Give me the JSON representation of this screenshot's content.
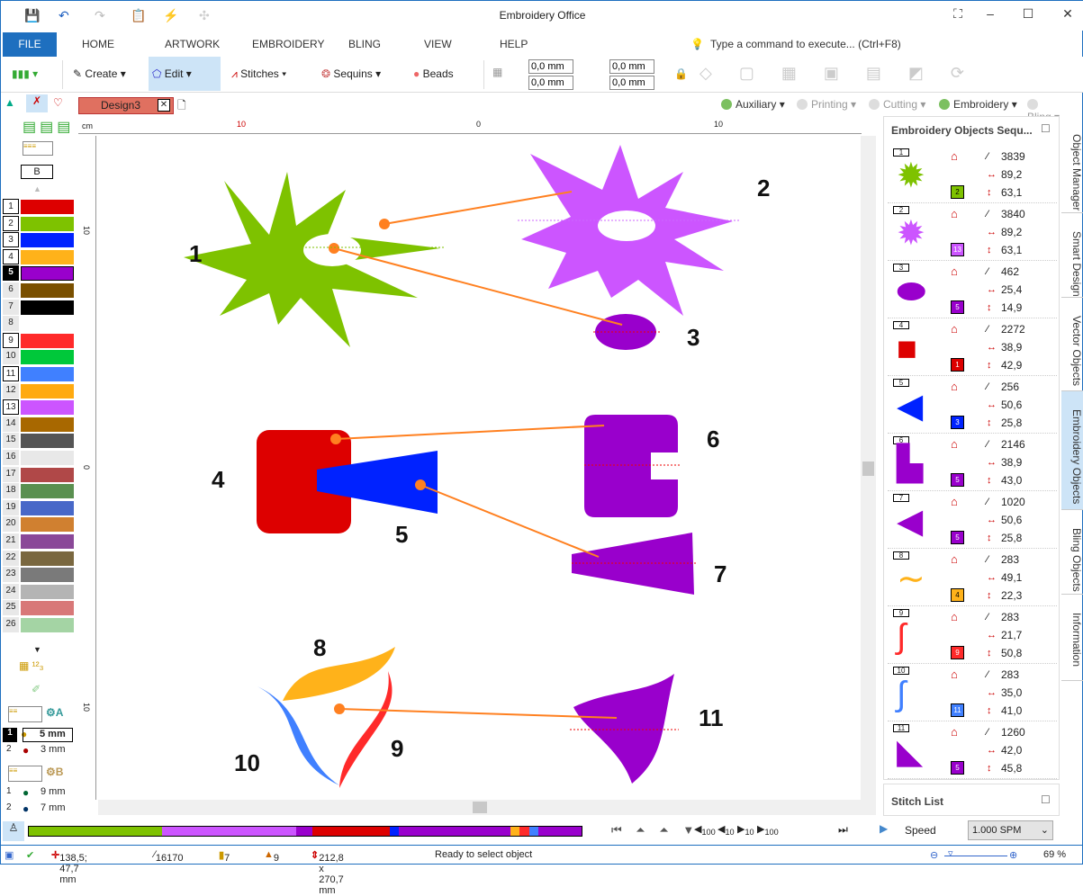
{
  "app": {
    "title": "Embroidery Office"
  },
  "ribbon_tabs": [
    "FILE",
    "HOME",
    "ARTWORK",
    "EMBROIDERY",
    "BLING",
    "VIEW",
    "HELP"
  ],
  "command_search": "Type a command to execute... (Ctrl+F8)",
  "toolbar": {
    "create": "Create",
    "edit": "Edit",
    "stitches": "Stitches",
    "sequins": "Sequins",
    "beads": "Beads",
    "pos_x": "0,0 mm",
    "pos_y": "0,0 mm",
    "width": "0,0 mm",
    "height": "0,0 mm"
  },
  "layers": [
    {
      "label": "Auxiliary",
      "on": true
    },
    {
      "label": "Printing",
      "on": false
    },
    {
      "label": "Cutting",
      "on": false
    },
    {
      "label": "Embroidery",
      "on": true
    },
    {
      "label": "Bling",
      "on": false
    }
  ],
  "document_tab": "Design3",
  "ruler": {
    "unit": "cm",
    "top_ticks": [
      "10",
      "0",
      "10"
    ],
    "left_ticks": [
      "10",
      "0",
      "10"
    ]
  },
  "palette_label": "B",
  "palette": [
    {
      "n": "1",
      "color": "#dd0000",
      "boxed": true
    },
    {
      "n": "2",
      "color": "#7ec200",
      "boxed": true
    },
    {
      "n": "3",
      "color": "#0022ff",
      "boxed": true
    },
    {
      "n": "4",
      "color": "#ffb21a",
      "boxed": true
    },
    {
      "n": "5",
      "color": "#9900cc",
      "selected": true
    },
    {
      "n": "6",
      "color": "#7a5000"
    },
    {
      "n": "7",
      "color": "#000000"
    },
    {
      "n": "8",
      "color": "#ffffff"
    },
    {
      "n": "9",
      "color": "#ff2a2a",
      "boxed": true
    },
    {
      "n": "10",
      "color": "#00c83a"
    },
    {
      "n": "11",
      "color": "#4080ff",
      "boxed": true
    },
    {
      "n": "12",
      "color": "#ffaa10"
    },
    {
      "n": "13",
      "color": "#cc55ff",
      "boxed": true
    },
    {
      "n": "14",
      "color": "#a86800"
    },
    {
      "n": "15",
      "color": "#555555"
    },
    {
      "n": "16",
      "color": "#e8e8e8"
    },
    {
      "n": "17",
      "color": "#b04848"
    },
    {
      "n": "18",
      "color": "#5a9050"
    },
    {
      "n": "19",
      "color": "#4868c8"
    },
    {
      "n": "20",
      "color": "#d08030"
    },
    {
      "n": "21",
      "color": "#8a4898"
    },
    {
      "n": "22",
      "color": "#7a6840"
    },
    {
      "n": "23",
      "color": "#7a7a7a"
    },
    {
      "n": "24",
      "color": "#b4b4b4"
    },
    {
      "n": "25",
      "color": "#d87878"
    },
    {
      "n": "26",
      "color": "#a4d4a4"
    }
  ],
  "sequins": {
    "a_label": "A",
    "a": [
      {
        "n": "1",
        "size": "5 mm"
      },
      {
        "n": "2",
        "size": "3 mm"
      }
    ],
    "b_label": "B",
    "b": [
      {
        "n": "1",
        "size": "9 mm"
      },
      {
        "n": "2",
        "size": "7 mm"
      }
    ]
  },
  "canvas_labels": [
    "1",
    "2",
    "3",
    "4",
    "5",
    "6",
    "7",
    "8",
    "9",
    "10",
    "11"
  ],
  "panel": {
    "title": "Embroidery Objects Sequ...",
    "stitch_list": "Stitch List",
    "items": [
      {
        "idx": "1",
        "stitches": "3839",
        "w": "89,2",
        "h": "63,1",
        "thread": "2",
        "color": "#7ec200"
      },
      {
        "idx": "2",
        "stitches": "3840",
        "w": "89,2",
        "h": "63,1",
        "thread": "13",
        "color": "#cc55ff"
      },
      {
        "idx": "3",
        "stitches": "462",
        "w": "25,4",
        "h": "14,9",
        "thread": "5",
        "color": "#9900cc"
      },
      {
        "idx": "4",
        "stitches": "2272",
        "w": "38,9",
        "h": "42,9",
        "thread": "1",
        "color": "#dd0000"
      },
      {
        "idx": "5",
        "stitches": "256",
        "w": "50,6",
        "h": "25,8",
        "thread": "3",
        "color": "#0022ff"
      },
      {
        "idx": "6",
        "stitches": "2146",
        "w": "38,9",
        "h": "43,0",
        "thread": "5",
        "color": "#9900cc"
      },
      {
        "idx": "7",
        "stitches": "1020",
        "w": "50,6",
        "h": "25,8",
        "thread": "5",
        "color": "#9900cc"
      },
      {
        "idx": "8",
        "stitches": "283",
        "w": "49,1",
        "h": "22,3",
        "thread": "4",
        "color": "#ffb21a"
      },
      {
        "idx": "9",
        "stitches": "283",
        "w": "21,7",
        "h": "50,8",
        "thread": "9",
        "color": "#ff2a2a"
      },
      {
        "idx": "10",
        "stitches": "283",
        "w": "35,0",
        "h": "41,0",
        "thread": "11",
        "color": "#4080ff"
      },
      {
        "idx": "11",
        "stitches": "1260",
        "w": "42,0",
        "h": "45,8",
        "thread": "5",
        "color": "#9900cc"
      }
    ]
  },
  "side_tabs": [
    "Object Manager",
    "Smart Design",
    "Vector Objects",
    "Embroidery Objects",
    "Bling Objects",
    "Information"
  ],
  "player": {
    "speed_label": "Speed",
    "speed": "1.000 SPM",
    "steps": [
      "100",
      "10",
      "10",
      "100"
    ]
  },
  "status": {
    "coords": "138,5; 47,7 mm",
    "stitches": "16170",
    "colors": "7",
    "objects": "9",
    "size": "212,8 x 270,7 mm",
    "message": "Ready to select object",
    "zoom": "69 %"
  }
}
